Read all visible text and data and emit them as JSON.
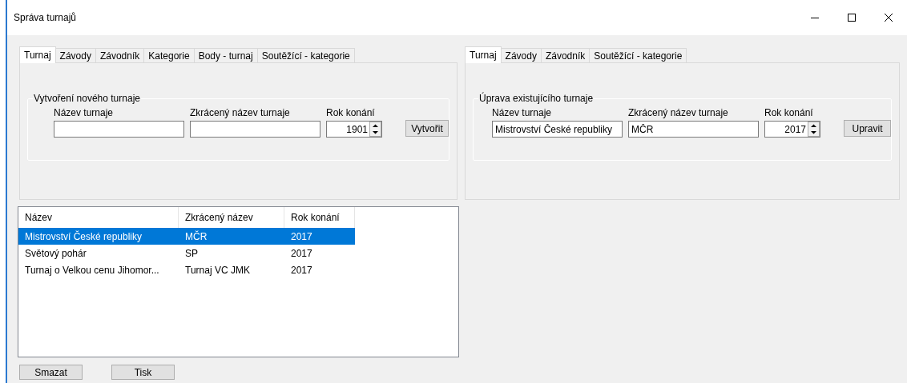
{
  "window": {
    "title": "Správa turnajů"
  },
  "left_panel": {
    "tabs": [
      {
        "label": "Turnaj",
        "selected": true
      },
      {
        "label": "Závody",
        "selected": false
      },
      {
        "label": "Závodník",
        "selected": false
      },
      {
        "label": "Kategorie",
        "selected": false
      },
      {
        "label": "Body - turnaj",
        "selected": false
      },
      {
        "label": "Soutěžící - kategorie",
        "selected": false
      }
    ],
    "group": {
      "title": "Vytvoření nového turnaje",
      "name_label": "Název turnaje",
      "short_label": "Zkrácený název turnaje",
      "year_label": "Rok konání",
      "year_value": "1901",
      "button": "Vytvořit"
    }
  },
  "right_panel": {
    "tabs": [
      {
        "label": "Turnaj",
        "selected": true
      },
      {
        "label": "Závody",
        "selected": false
      },
      {
        "label": "Závodník",
        "selected": false
      },
      {
        "label": "Soutěžící - kategorie",
        "selected": false
      }
    ],
    "group": {
      "title": "Úprava existujícího turnaje",
      "name_label": "Název turnaje",
      "name_value": "Mistrovství České republiky",
      "short_label": "Zkrácený název turnaje",
      "short_value": "MČR",
      "year_label": "Rok konání",
      "year_value": "2017",
      "button": "Upravit"
    }
  },
  "table": {
    "columns": [
      "Název",
      "Zkrácený název",
      "Rok konání"
    ],
    "rows": [
      {
        "cells": [
          "Mistrovství České republiky",
          "MČR",
          "2017"
        ],
        "selected": true
      },
      {
        "cells": [
          "Světový pohár",
          "SP",
          "2017"
        ],
        "selected": false
      },
      {
        "cells": [
          "Turnaj o Velkou cenu Jihomor...",
          "Turnaj VC JMK",
          "2017"
        ],
        "selected": false
      }
    ]
  },
  "buttons": [
    "Smazat",
    "Tisk"
  ]
}
